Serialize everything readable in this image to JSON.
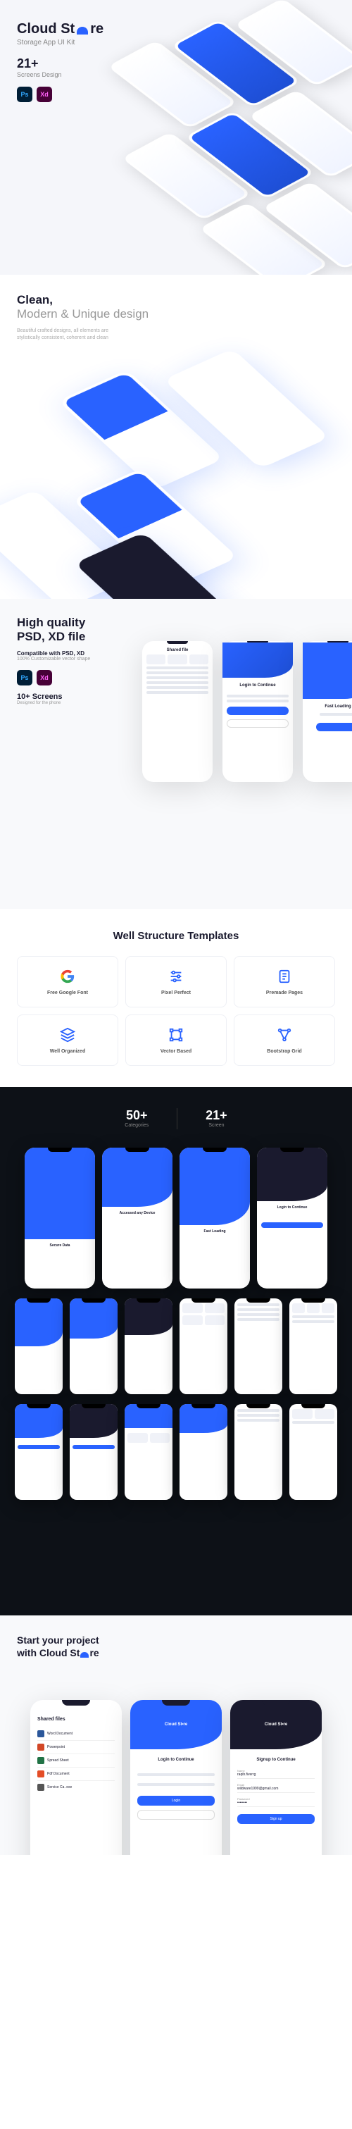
{
  "brand": {
    "name_part1": "Cloud St",
    "name_part2": "re",
    "tagline": "Storage App UI Kit"
  },
  "hero": {
    "count": "21+",
    "count_label": "Screens Design",
    "tools": {
      "ps": "Ps",
      "xd": "Xd"
    }
  },
  "clean": {
    "title": "Clean,",
    "subtitle": "Modern & Unique design",
    "desc": "Beautiful crafted designs, all elements are stylistically consistent, coherent and clean",
    "phone_labels": {
      "accessed": "Accessed any Device",
      "fast": "Fast Loading",
      "secure": "Secure Data"
    }
  },
  "hq": {
    "title_line1": "High quality",
    "title_line2": "PSD, XD file",
    "compat": "Compatible with  PSD, XD",
    "compat_sub": "100% Customizable vector shape",
    "screens": "10+ Screens",
    "screens_sub": "Designed for the phone",
    "phone1": {
      "title": "Shared file"
    },
    "phone2": {
      "title": "Login to Continue"
    },
    "phone3": {
      "title": "Fast Loading"
    }
  },
  "well": {
    "title": "Well Structure Templates",
    "features": [
      {
        "icon": "google",
        "label": "Free Google Font"
      },
      {
        "icon": "sliders",
        "label": "Pixel Perfect"
      },
      {
        "icon": "pages",
        "label": "Premade Pages"
      },
      {
        "icon": "layers",
        "label": "Well Organized"
      },
      {
        "icon": "vector",
        "label": "Vector Based"
      },
      {
        "icon": "grid",
        "label": "Bootstrap Grid"
      }
    ]
  },
  "dark": {
    "categories": "50+",
    "categories_label": "Categories",
    "screens": "21+",
    "screens_label": "Screen",
    "row1_labels": [
      "Secure Data",
      "Accessed any Device",
      "Fast Loading",
      "Login to Continue"
    ],
    "row2_count": 6
  },
  "start": {
    "title_line1": "Start your project",
    "title_line2": "with Cloud St",
    "title_line3": "re",
    "left_phone": {
      "title": "Shared files",
      "items": [
        "Word Document",
        "Powerpoint",
        "Spread Sheet",
        "Pdf Document",
        "Service Ca .exe"
      ]
    },
    "mid_phone": {
      "title": "Login to Continue",
      "btn": "Login"
    },
    "right_phone": {
      "title": "Signup to Continue",
      "name": "raqib.fiverrg",
      "email": "wildware1999@gmail.com",
      "pwd": "••••••••",
      "btn": "Sign up"
    }
  }
}
